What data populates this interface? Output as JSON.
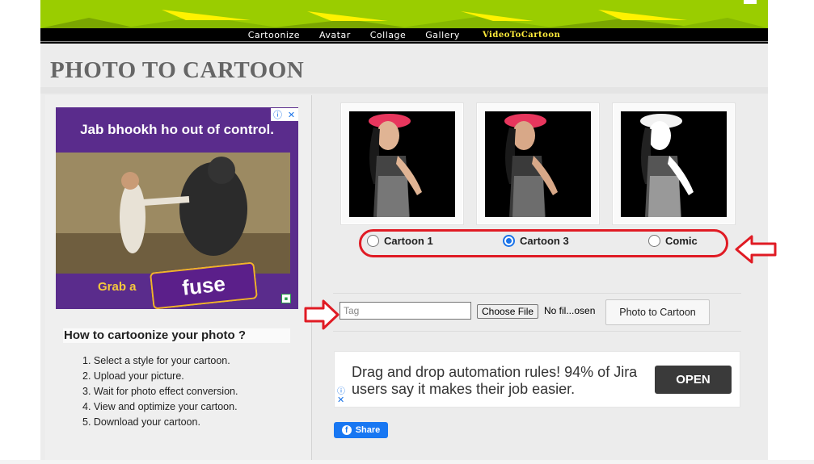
{
  "nav": {
    "items": [
      {
        "label": "Cartoonize"
      },
      {
        "label": "Avatar"
      },
      {
        "label": "Collage"
      },
      {
        "label": "Gallery"
      }
    ],
    "special": "VideoToCartoon"
  },
  "page_title": "PHOTO TO CARTOON",
  "sidebar": {
    "ad": {
      "headline": "Jab bhookh ho out of control.",
      "cta": "Grab a",
      "brand": "fuse"
    },
    "howto_title": "How to cartoonize your photo ?",
    "steps": [
      "1. Select a style for your cartoon.",
      "2. Upload your picture.",
      "3. Wait for photo effect conversion.",
      "4. View and optimize your cartoon.",
      "5. Download your cartoon."
    ]
  },
  "styles": {
    "options": [
      {
        "label": "Cartoon 1",
        "checked": false
      },
      {
        "label": "Cartoon 3",
        "checked": true
      },
      {
        "label": "Comic",
        "checked": false
      }
    ]
  },
  "upload": {
    "tag_placeholder": "Tag",
    "choose_file": "Choose File",
    "file_status": "No fil...osen",
    "submit": "Photo to Cartoon"
  },
  "ad2": {
    "text": "Drag and drop automation rules! 94% of Jira users say it makes their job easier.",
    "button": "OPEN"
  },
  "share": {
    "label": "Share"
  },
  "colors": {
    "banner": "#9acd00",
    "annotation_red": "#e01b24",
    "facebook_blue": "#1877f2",
    "radio_blue": "#1a73e8"
  }
}
